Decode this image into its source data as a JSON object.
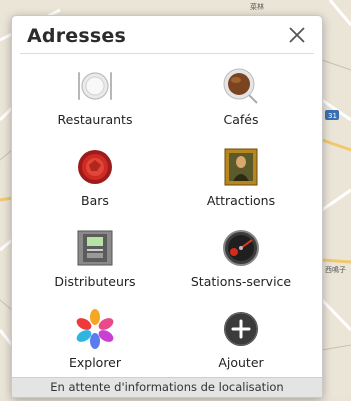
{
  "dialog": {
    "title": "Adresses",
    "close_icon": "close-icon"
  },
  "items": [
    {
      "label": "Restaurants",
      "icon": "plate-cutlery-icon"
    },
    {
      "label": "Cafés",
      "icon": "coffee-cup-icon"
    },
    {
      "label": "Bars",
      "icon": "bottle-cap-icon"
    },
    {
      "label": "Attractions",
      "icon": "mona-lisa-painting-icon"
    },
    {
      "label": "Distributeurs",
      "icon": "atm-icon"
    },
    {
      "label": "Stations-service",
      "icon": "fuel-gauge-icon"
    },
    {
      "label": "Explorer",
      "icon": "flower-icon"
    },
    {
      "label": "Ajouter",
      "icon": "add-icon"
    }
  ],
  "status_text": "En attente d'informations de localisation",
  "map_labels": {
    "route": "31",
    "kanji_1": "西鳴子",
    "kanji_2": "菜林"
  }
}
